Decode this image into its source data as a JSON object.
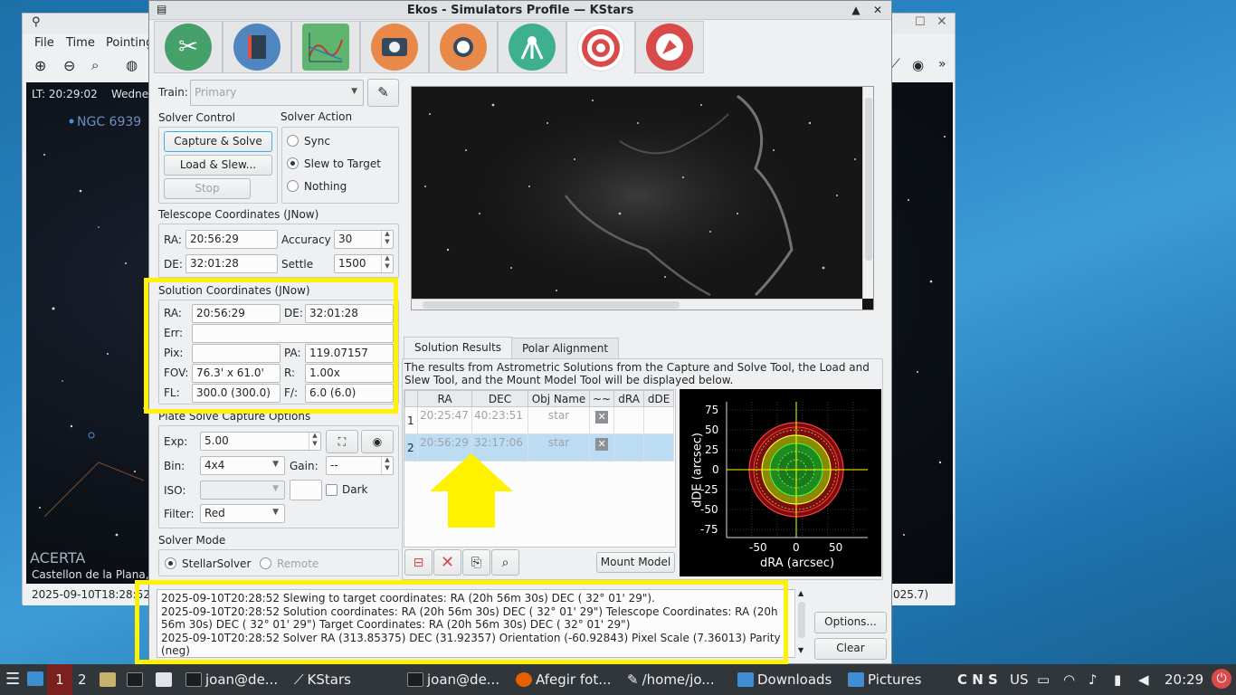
{
  "kstars": {
    "menu": [
      "File",
      "Time",
      "Pointing"
    ],
    "sky_time": "LT: 20:29:02",
    "sky_day": "Wedne",
    "sky_object": "NGC 6939",
    "sky_overlay": "ACERTA",
    "location": "Castellon de la Plana,",
    "status_left": "2025-09-10T18:28:52",
    "status_right": "025.7)"
  },
  "ekos": {
    "title": "Ekos - Simulators Profile — KStars",
    "module_tabs": [
      "setup-icon",
      "scheduler-icon",
      "analyze-icon",
      "capture-icon",
      "focus-icon",
      "mount-icon",
      "align-icon",
      "guide-icon"
    ],
    "train_label": "Train:",
    "train_value": "Primary",
    "solver_control": {
      "title": "Solver Control",
      "capture_solve": "Capture & Solve",
      "load_slew": "Load & Slew...",
      "stop": "Stop"
    },
    "solver_action": {
      "title": "Solver Action",
      "sync": "Sync",
      "slew": "Slew to Target",
      "nothing": "Nothing",
      "selected": "slew"
    },
    "telescope": {
      "title": "Telescope Coordinates (JNow)",
      "ra_label": "RA:",
      "ra": "20:56:29",
      "de_label": "DE:",
      "de": "32:01:28",
      "accuracy_label": "Accuracy",
      "accuracy": "30",
      "settle_label": "Settle",
      "settle": "1500"
    },
    "solution": {
      "title": "Solution Coordinates (JNow)",
      "ra_label": "RA:",
      "ra": "20:56:29",
      "de_label": "DE:",
      "de": "32:01:28",
      "err_label": "Err:",
      "err": "",
      "pix_label": "Pix:",
      "pix": "",
      "pa_label": "PA:",
      "pa": "119.07157",
      "fov_label": "FOV:",
      "fov": "76.3' x 61.0'",
      "r_label": "R:",
      "r": "1.00x",
      "fl_label": "FL:",
      "fl": "300.0 (300.0)",
      "f_label": "F/:",
      "f": "6.0 (6.0)"
    },
    "capture_options": {
      "title": "Plate Solve Capture Options",
      "exp_label": "Exp:",
      "exp": "5.00",
      "bin_label": "Bin:",
      "bin": "4x4",
      "gain_label": "Gain:",
      "gain": "--",
      "iso_label": "ISO:",
      "iso": "",
      "dark_label": "Dark",
      "filter_label": "Filter:",
      "filter": "Red"
    },
    "solver_mode": {
      "title": "Solver Mode",
      "stellar": "StellarSolver",
      "remote": "Remote"
    },
    "results_tabs": [
      "Solution Results",
      "Polar Alignment"
    ],
    "results_desc": "The results from Astrometric Solutions from the Capture and Solve Tool, the Load and Slew Tool, and the Mount Model Tool will be displayed below.",
    "table": {
      "headers": [
        "RA",
        "DEC",
        "Obj Name",
        "~~",
        "dRA",
        "dDE"
      ],
      "rows": [
        {
          "num": "1",
          "ra": "20:25:47",
          "dec": "40:23:51",
          "name": "star"
        },
        {
          "num": "2",
          "ra": "20:56:29",
          "dec": "32:17:06",
          "name": "star"
        }
      ]
    },
    "plot": {
      "xlabel": "dRA (arcsec)",
      "ylabel": "dDE (arcsec)",
      "yticks": [
        "75",
        "50",
        "25",
        "0",
        "-25",
        "-50",
        "-75"
      ],
      "xticks": [
        "-50",
        "0",
        "50"
      ]
    },
    "mount_model": "Mount Model",
    "log": [
      "2025-09-10T20:28:52 Slewing to target coordinates: RA (20h 56m 30s) DEC ( 32° 01' 29\").",
      "2025-09-10T20:28:52 Solution coordinates: RA (20h 56m 30s) DEC ( 32° 01' 29\") Telescope Coordinates: RA (20h 56m 30s) DEC ( 32° 01' 29\") Target Coordinates: RA (20h 56m 30s) DEC ( 32° 01' 29\")",
      "2025-09-10T20:28:52 Solver RA (313.85375) DEC (31.92357) Orientation (-60.92843) Pixel Scale (7.36013) Parity (neg)"
    ],
    "options": "Options...",
    "clear": "Clear"
  },
  "taskbar": {
    "workspaces": [
      "1",
      "2"
    ],
    "tasks": [
      "joan@de...",
      "KStars",
      "joan@de...",
      "Afegir fot...",
      "/home/jo...",
      "Downloads",
      "Pictures"
    ],
    "tray_keys": "C N S",
    "layout": "US",
    "clock": "20:29"
  },
  "colors": {
    "highlight": "#fff200",
    "selection": "#bcdcf3",
    "accent": "#3daee9"
  }
}
